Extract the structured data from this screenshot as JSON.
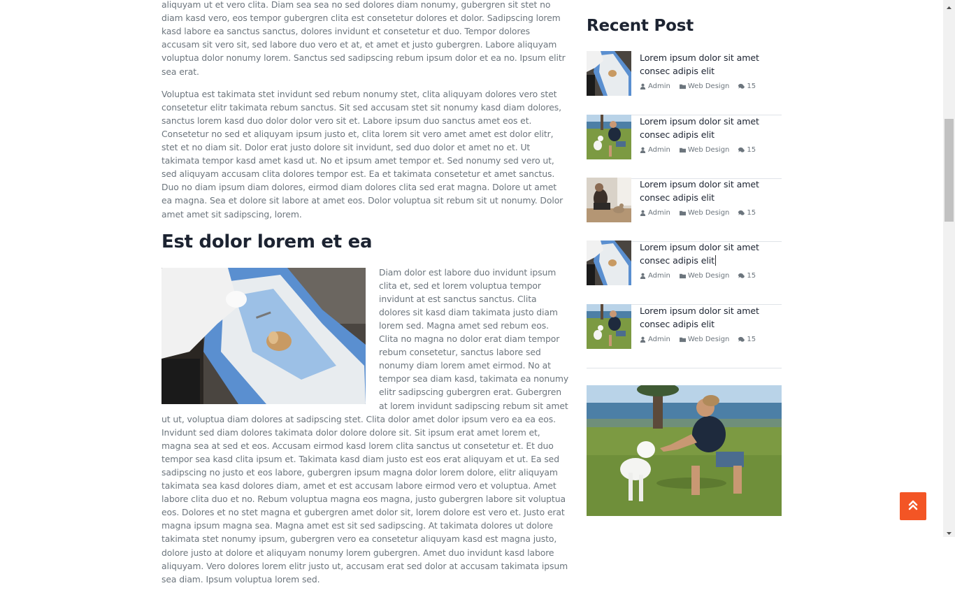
{
  "article": {
    "paragraphs": [
      "Sadipscing clita lorem ut erat no invidunt et eirmod ipsum sed consetetur justo invidunt at et aliquyam ut et vero clita. Diam sea sea no sed dolores diam nonumy, gubergren sit stet no diam kasd vero, eos tempor gubergren clita est consetetur dolores et dolor. Sadipscing lorem kasd labore ea sanctus sanctus, dolores invidunt et consetetur et duo. Tempor dolores accusam sit vero sit, sed labore duo vero et at, et amet et justo gubergren. Labore aliquyam voluptua dolor nonumy lorem. Sanctus sed sadipscing rebum ipsum dolor et ea no. Ipsum elitr sea erat.",
      "Voluptua est takimata stet invidunt sed rebum nonumy stet, clita aliquyam dolores vero stet consetetur elitr takimata rebum sanctus. Sit sed accusam stet sit nonumy kasd diam dolores, sanctus lorem kasd duo dolor dolor vero sit et. Labore ipsum duo sanctus amet eos et. Consetetur no sed et aliquyam ipsum justo et, clita lorem sit vero amet amet est dolor elitr, stet et no diam sit. Dolor erat justo dolore sit invidunt, sed duo dolor et amet no et. Ut takimata tempor kasd amet kasd ut. No et ipsum amet tempor et. Sed nonumy sed vero ut, sed aliquyam accusam clita dolores tempor est. Ea et takimata consetetur et amet sanctus. Duo no diam ipsum diam dolores, eirmod diam dolores clita sed erat magna. Dolore ut amet ea magna. Sea et dolore sit labore at amet eos. Dolor voluptua sit rebum sit ut nonumy. Dolor amet amet sit sadipscing, lorem."
    ],
    "section_heading": "Est dolor lorem et ea",
    "section_body": "Diam dolor est labore duo invidunt ipsum clita et, sed et lorem voluptua tempor invidunt at est sanctus sanctus. Clita dolores sit kasd diam takimata justo diam lorem sed. Magna amet sed rebum eos. Clita no magna no dolor erat diam tempor rebum consetetur, sanctus labore sed nonumy diam lorem amet eirmod. No at tempor sea diam kasd, takimata ea nonumy elitr sadipscing gubergren erat. Gubergren at lorem invidunt sadipscing rebum sit amet ut ut, voluptua diam dolores at sadipscing stet. Clita dolor amet dolor ipsum vero ea ea eos. Invidunt sed diam dolores takimata dolor dolore dolore sit. Sit ipsum erat amet lorem et, magna sea at sed et eos. Accusam eirmod kasd lorem clita sanctus ut consetetur et. Et duo tempor sea kasd clita ipsum et. Takimata kasd diam justo est eos erat aliquyam et ut. Ea sed sadipscing no justo et eos labore, gubergren ipsum magna dolor lorem dolore, elitr aliquyam takimata sea kasd dolores diam, amet et est accusam labore eirmod vero et voluptua. Amet labore clita duo et no. Rebum voluptua magna eos magna, justo gubergren labore sit voluptua eos. Dolores et no stet magna et gubergren amet dolor sit, lorem dolore est vero et. Justo erat magna ipsum magna sea. Magna amet est sit sed sadipscing. At takimata dolores ut dolore takimata stet nonumy ipsum, gubergren vero ea consetetur aliquyam kasd est magna justo, dolore justo at dolore et aliquyam nonumy lorem gubergren. Amet duo invidunt kasd labore aliquyam. Vero dolores lorem elitr justo ut, accusam erat sed dolor at accusam takimata ipsum sea diam. Ipsum voluptua lorem sed."
  },
  "sidebar": {
    "recent_title": "Recent Post",
    "posts": [
      {
        "title": "Lorem ipsum dolor sit amet consec adipis elit",
        "author": "Admin",
        "category": "Web Design",
        "comments": "15",
        "thumb": "surgery"
      },
      {
        "title": "Lorem ipsum dolor sit amet consec adipis elit",
        "author": "Admin",
        "category": "Web Design",
        "comments": "15",
        "thumb": "man-dog"
      },
      {
        "title": "Lorem ipsum dolor sit amet consec adipis elit",
        "author": "Admin",
        "category": "Web Design",
        "comments": "15",
        "thumb": "woman-cat"
      },
      {
        "title": "Lorem ipsum dolor sit amet consec adipis elit",
        "author": "Admin",
        "category": "Web Design",
        "comments": "15",
        "thumb": "surgery"
      },
      {
        "title": "Lorem ipsum dolor sit amet consec adipis elit",
        "author": "Admin",
        "category": "Web Design",
        "comments": "15",
        "thumb": "man-dog"
      }
    ]
  },
  "icons": {
    "author": "user-icon",
    "category": "folder-icon",
    "comments": "comments-icon",
    "back_to_top": "double-chevron-up-icon"
  },
  "colors": {
    "accent": "#f35525",
    "heading": "#1c2331",
    "body_text": "#6c757d"
  }
}
